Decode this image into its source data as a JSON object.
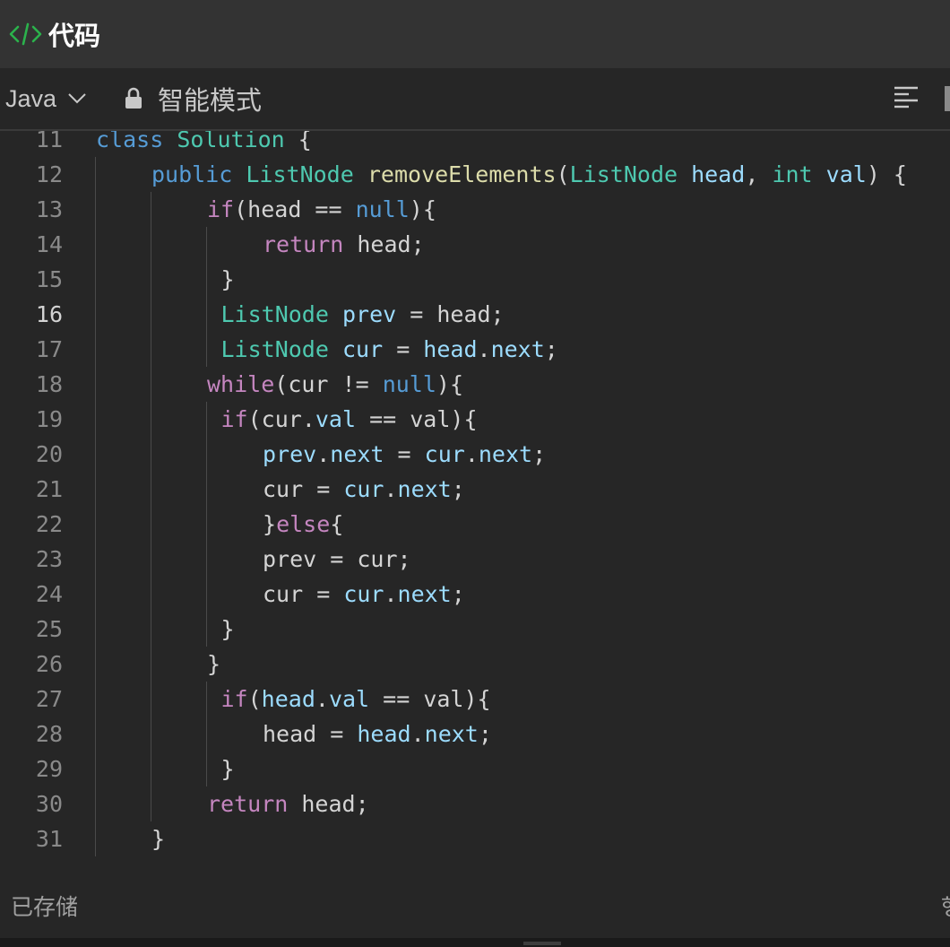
{
  "header": {
    "title": "代码",
    "icon": "code-icon",
    "icon_color": "#2bb24c"
  },
  "toolbar": {
    "language": "Java",
    "mode_label": "智能模式"
  },
  "editor": {
    "active_line": 16,
    "lines": [
      {
        "no": "11",
        "indent": 0,
        "tokens": [
          [
            "kb",
            "class"
          ],
          [
            "p",
            " "
          ],
          [
            "ty",
            "Solution"
          ],
          [
            "p",
            " {"
          ]
        ]
      },
      {
        "no": "12",
        "indent": 1,
        "tokens": [
          [
            "kb",
            "public"
          ],
          [
            "p",
            " "
          ],
          [
            "ty",
            "ListNode"
          ],
          [
            "p",
            " "
          ],
          [
            "fn",
            "removeElements"
          ],
          [
            "p",
            "("
          ],
          [
            "ty",
            "ListNode"
          ],
          [
            "p",
            " "
          ],
          [
            "var",
            "head"
          ],
          [
            "p",
            ", "
          ],
          [
            "ty",
            "int"
          ],
          [
            "p",
            " "
          ],
          [
            "var",
            "val"
          ],
          [
            "p",
            ") {"
          ]
        ]
      },
      {
        "no": "13",
        "indent": 2,
        "tokens": [
          [
            "kw",
            "if"
          ],
          [
            "p",
            "(head == "
          ],
          [
            "kb",
            "null"
          ],
          [
            "p",
            "){"
          ]
        ]
      },
      {
        "no": "14",
        "indent": 3,
        "tokens": [
          [
            "kw",
            "return"
          ],
          [
            "p",
            " head;"
          ]
        ]
      },
      {
        "no": "15",
        "indent": 2.25,
        "tokens": [
          [
            "p",
            "}"
          ]
        ]
      },
      {
        "no": "16",
        "indent": 2.25,
        "tokens": [
          [
            "ty",
            "ListNode"
          ],
          [
            "p",
            " "
          ],
          [
            "var",
            "prev"
          ],
          [
            "p",
            " = head;"
          ]
        ]
      },
      {
        "no": "17",
        "indent": 2.25,
        "tokens": [
          [
            "ty",
            "ListNode"
          ],
          [
            "p",
            " "
          ],
          [
            "var",
            "cur"
          ],
          [
            "p",
            " = "
          ],
          [
            "var",
            "head"
          ],
          [
            "p",
            "."
          ],
          [
            "var",
            "next"
          ],
          [
            "p",
            ";"
          ]
        ]
      },
      {
        "no": "18",
        "indent": 2,
        "tokens": [
          [
            "kw",
            "while"
          ],
          [
            "p",
            "(cur != "
          ],
          [
            "kb",
            "null"
          ],
          [
            "p",
            "){"
          ]
        ]
      },
      {
        "no": "19",
        "indent": 2.25,
        "tokens": [
          [
            "kw",
            "if"
          ],
          [
            "p",
            "(cur."
          ],
          [
            "var",
            "val"
          ],
          [
            "p",
            " == val){"
          ]
        ]
      },
      {
        "no": "20",
        "indent": 3,
        "tokens": [
          [
            "var",
            "prev"
          ],
          [
            "p",
            "."
          ],
          [
            "var",
            "next"
          ],
          [
            "p",
            " = "
          ],
          [
            "var",
            "cur"
          ],
          [
            "p",
            "."
          ],
          [
            "var",
            "next"
          ],
          [
            "p",
            ";"
          ]
        ]
      },
      {
        "no": "21",
        "indent": 3,
        "tokens": [
          [
            "p",
            "cur = "
          ],
          [
            "var",
            "cur"
          ],
          [
            "p",
            "."
          ],
          [
            "var",
            "next"
          ],
          [
            "p",
            ";"
          ]
        ]
      },
      {
        "no": "22",
        "indent": 3,
        "tokens": [
          [
            "p",
            "}"
          ],
          [
            "kw",
            "else"
          ],
          [
            "p",
            "{"
          ]
        ]
      },
      {
        "no": "23",
        "indent": 3,
        "tokens": [
          [
            "p",
            "prev = cur;"
          ]
        ]
      },
      {
        "no": "24",
        "indent": 3,
        "tokens": [
          [
            "p",
            "cur = "
          ],
          [
            "var",
            "cur"
          ],
          [
            "p",
            "."
          ],
          [
            "var",
            "next"
          ],
          [
            "p",
            ";"
          ]
        ]
      },
      {
        "no": "25",
        "indent": 2.25,
        "tokens": [
          [
            "p",
            "}"
          ]
        ]
      },
      {
        "no": "26",
        "indent": 2,
        "tokens": [
          [
            "p",
            "}"
          ]
        ]
      },
      {
        "no": "27",
        "indent": 2.25,
        "tokens": [
          [
            "kw",
            "if"
          ],
          [
            "p",
            "("
          ],
          [
            "var",
            "head"
          ],
          [
            "p",
            "."
          ],
          [
            "var",
            "val"
          ],
          [
            "p",
            " == val){"
          ]
        ]
      },
      {
        "no": "28",
        "indent": 3,
        "tokens": [
          [
            "p",
            "head = "
          ],
          [
            "var",
            "head"
          ],
          [
            "p",
            "."
          ],
          [
            "var",
            "next"
          ],
          [
            "p",
            ";"
          ]
        ]
      },
      {
        "no": "29",
        "indent": 2.25,
        "tokens": [
          [
            "p",
            "}"
          ]
        ]
      },
      {
        "no": "30",
        "indent": 2,
        "tokens": [
          [
            "kw",
            "return"
          ],
          [
            "p",
            " head;"
          ]
        ]
      },
      {
        "no": "31",
        "indent": 1,
        "tokens": [
          [
            "p",
            "}"
          ]
        ]
      }
    ]
  },
  "status": {
    "saved_label": "已存储",
    "right_edge_char": "행"
  }
}
